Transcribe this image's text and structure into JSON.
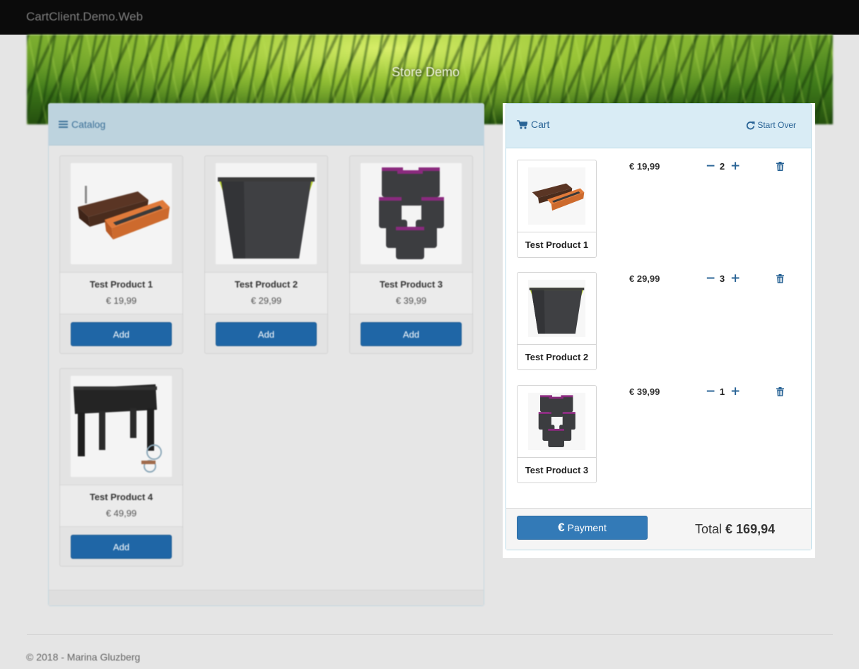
{
  "navbar": {
    "brand": "CartClient.Demo.Web"
  },
  "banner": {
    "title": "Store Demo"
  },
  "catalog": {
    "title": "Catalog",
    "add_label": "Add",
    "products": [
      {
        "name": "Test Product 1",
        "price": "€ 19,99",
        "image": "planter-boxes"
      },
      {
        "name": "Test Product 2",
        "price": "€ 29,99",
        "image": "square-pot"
      },
      {
        "name": "Test Product 3",
        "price": "€ 39,99",
        "image": "stacked-pots"
      },
      {
        "name": "Test Product 4",
        "price": "€ 49,99",
        "image": "raised-bed-table"
      }
    ]
  },
  "cart": {
    "title": "Cart",
    "start_over": "Start Over",
    "items": [
      {
        "name": "Test Product 1",
        "price": "€ 19,99",
        "qty": "2",
        "image": "planter-boxes"
      },
      {
        "name": "Test Product 2",
        "price": "€ 29,99",
        "qty": "3",
        "image": "square-pot"
      },
      {
        "name": "Test Product 3",
        "price": "€ 39,99",
        "qty": "1",
        "image": "stacked-pots"
      }
    ],
    "payment_symbol": "€",
    "payment_label": "Payment",
    "total_label": "Total",
    "total_value": "€ 169,94"
  },
  "footer": {
    "copyright": "© 2018 - Marina Gluzberg"
  },
  "colors": {
    "accent": "#337ab7",
    "add_button": "#1f66a6",
    "cart_header": "#d9ecf5",
    "catalog_header": "#bdd3de",
    "navbar": "#0b0b0b"
  }
}
